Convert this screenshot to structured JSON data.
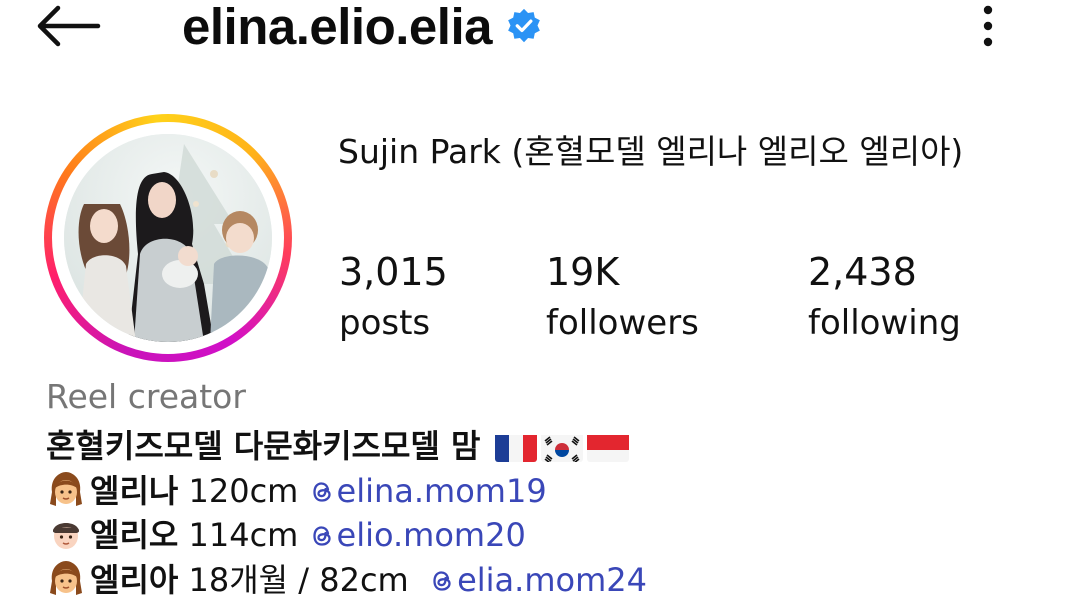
{
  "header": {
    "username": "elina.elio.elia",
    "verified_color": "#2b93f5"
  },
  "profile": {
    "display_name": "Sujin Park (혼혈모델 엘리나 엘리오 엘리아)"
  },
  "stats": [
    {
      "value": "3,015",
      "label": "posts"
    },
    {
      "value": "19K",
      "label": "followers"
    },
    {
      "value": "2,438",
      "label": "following"
    }
  ],
  "category": "Reel creator",
  "bio": {
    "line1": "혼혈키즈모델 다문화키즈모델 맘",
    "line1_flags": [
      "flag-france",
      "flag-south-korea",
      "flag-indonesia"
    ],
    "children": [
      {
        "icon": "girl-emoji",
        "name": "엘리나",
        "info": "120cm",
        "handle": "elina.mom19"
      },
      {
        "icon": "boy-emoji",
        "name": "엘리오",
        "info": "114cm",
        "handle": "elio.mom20"
      },
      {
        "icon": "girl-emoji",
        "name": "엘리아",
        "info": "18개월 / 82cm ",
        "handle": "elia.mom24"
      }
    ]
  },
  "colors": {
    "mention": "#3a47b8",
    "muted": "#767676",
    "story_ring": [
      "#c913b9",
      "#ff1f6b",
      "#ffd21a"
    ]
  }
}
